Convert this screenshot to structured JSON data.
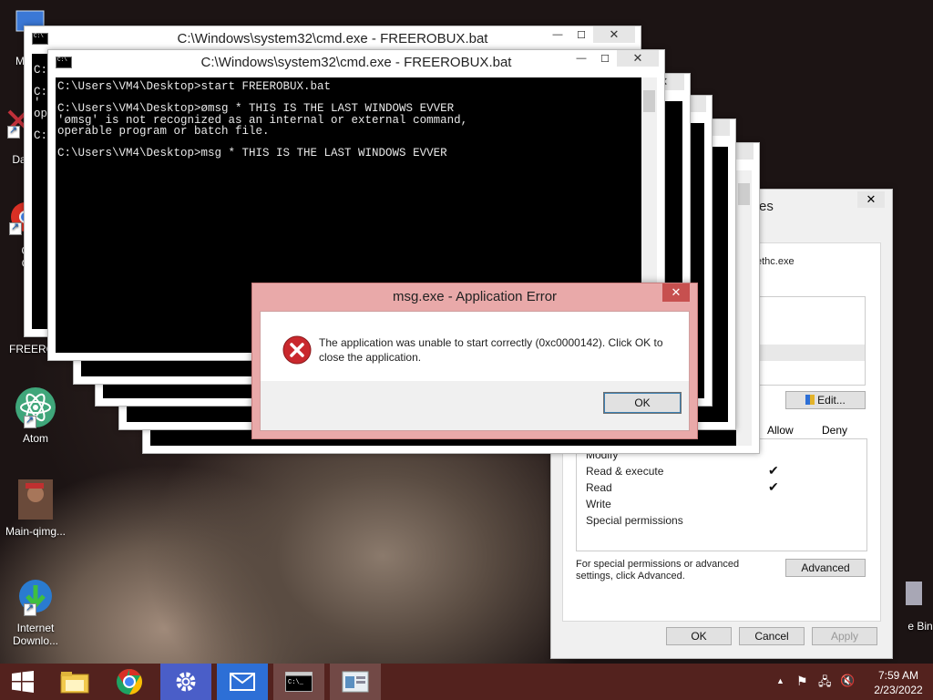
{
  "desktop": {
    "icons": [
      {
        "label": "My C"
      },
      {
        "label": "Data"
      },
      {
        "label": "G"
      },
      {
        "label": "C"
      },
      {
        "label": "FREEROB"
      },
      {
        "label": "Atom"
      },
      {
        "label": "Main-qimg..."
      },
      {
        "label": "Internet"
      },
      {
        "label": "Downlo..."
      },
      {
        "label": "e Bin"
      }
    ]
  },
  "cmd_back": {
    "title": "C:\\Windows\\system32\\cmd.exe - FREEROBUX.bat",
    "partial_lines": [
      "C:",
      "C:",
      "'",
      "op",
      "C:"
    ]
  },
  "cmd_front": {
    "title": "C:\\Windows\\system32\\cmd.exe - FREEROBUX.bat",
    "text": "C:\\Users\\VM4\\Desktop>start FREEROBUX.bat\n\nC:\\Users\\VM4\\Desktop>ømsg * THIS IS THE LAST WINDOWS EVVER\n'ømsg' is not recognized as an internal or external command,\noperable program or batch file.\n\nC:\\Users\\VM4\\Desktop>msg * THIS IS THE LAST WINDOWS EVVER"
  },
  "error_dialog": {
    "title": "msg.exe - Application Error",
    "message": "The application was unable to start correctly (0xc0000142). Click OK to close the application.",
    "ok_label": "OK"
  },
  "properties_dialog": {
    "title_fragment": "es",
    "object_fragment": "ethc.exe",
    "edit_label": "Edit...",
    "allow_header": "Allow",
    "deny_header": "Deny",
    "permissions": [
      {
        "name": "Modify",
        "allow": false
      },
      {
        "name": "Read & execute",
        "allow": true
      },
      {
        "name": "Read",
        "allow": true
      },
      {
        "name": "Write",
        "allow": false
      },
      {
        "name": "Special permissions",
        "allow": false
      }
    ],
    "advanced_text": "For special permissions or advanced settings, click Advanced.",
    "advanced_label": "Advanced",
    "ok_label": "OK",
    "cancel_label": "Cancel",
    "apply_label": "Apply"
  },
  "taskbar": {
    "time": "7:59 AM",
    "date": "2/23/2022"
  }
}
